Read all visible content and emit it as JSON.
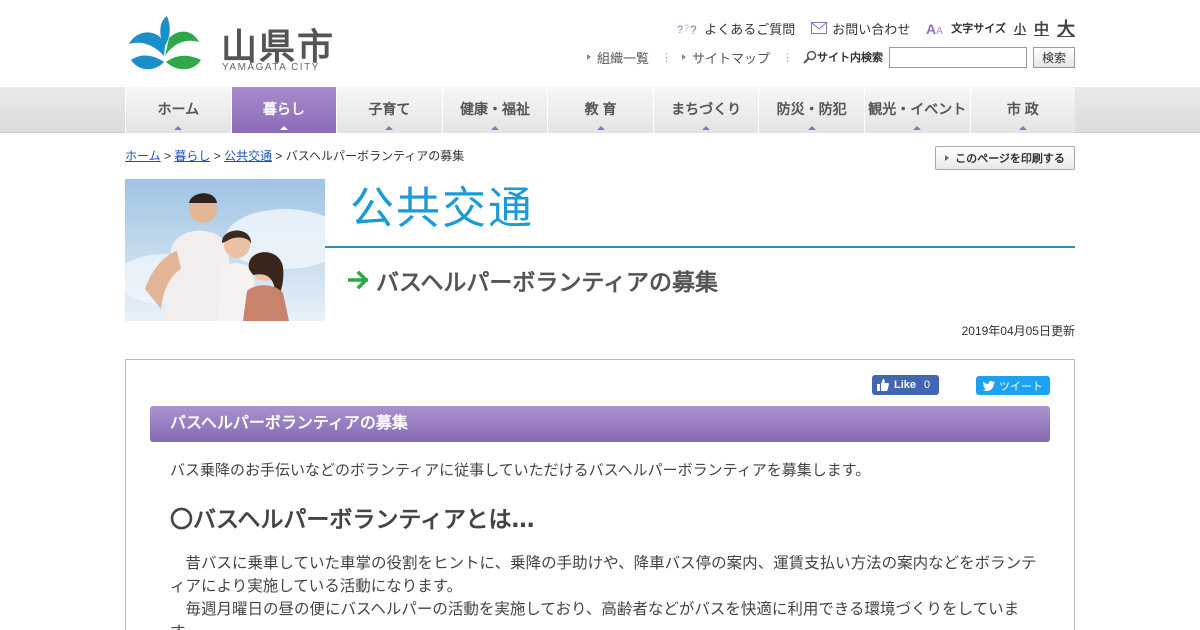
{
  "header": {
    "logo_name": "山県市",
    "logo_sub": "YAMAGATA CITY",
    "faq_label": "よくあるご質問",
    "contact_label": "お問い合わせ",
    "font_size_label": "文字サイズ",
    "font_size_small": "小",
    "font_size_medium": "中",
    "font_size_large": "大",
    "org_list_label": "組織一覧",
    "sitemap_label": "サイトマップ",
    "search_label": "サイト内検索",
    "search_value": "",
    "search_button": "検索"
  },
  "nav": [
    {
      "label": "ホーム",
      "active": false
    },
    {
      "label": "暮らし",
      "active": true
    },
    {
      "label": "子育て",
      "active": false
    },
    {
      "label": "健康・福祉",
      "active": false
    },
    {
      "label": "教 育",
      "active": false
    },
    {
      "label": "まちづくり",
      "active": false
    },
    {
      "label": "防災・防犯",
      "active": false
    },
    {
      "label": "観光・イベント",
      "active": false
    },
    {
      "label": "市 政",
      "active": false
    }
  ],
  "breadcrumb": {
    "home": "ホーム",
    "sep": ">",
    "level1": "暮らし",
    "level2": "公共交通",
    "current": "バスヘルパーボランティアの募集"
  },
  "print_label": "このページを印刷する",
  "section_title": "公共交通",
  "page_title": "バスヘルパーボランティアの募集",
  "updated": "2019年04月05日更新",
  "social": {
    "fb_label": "Like",
    "fb_count": "0",
    "tw_label": "ツイート"
  },
  "article": {
    "heading": "バスヘルパーボランティアの募集",
    "intro": "バス乗降のお手伝いなどのボランティアに従事していただけるバスヘルパーボランティアを募集します。",
    "subheading": "〇バスヘルパーボランティアとは…",
    "para1": "昔バスに乗車していた車掌の役割をヒントに、乗降の手助けや、降車バス停の案内、運賃支払い方法の案内などをボランティアにより実施している活動になります。",
    "para2": "毎週月曜日の昼の便にバスヘルパーの活動を実施しており、高齢者などがバスを快適に利用できる環境づくりをしています。"
  },
  "colors": {
    "accent_purple": "#8a6bb6",
    "title_blue": "#1a9ad6",
    "logo_blue": "#1a8fc9",
    "logo_green": "#2ea84a"
  }
}
